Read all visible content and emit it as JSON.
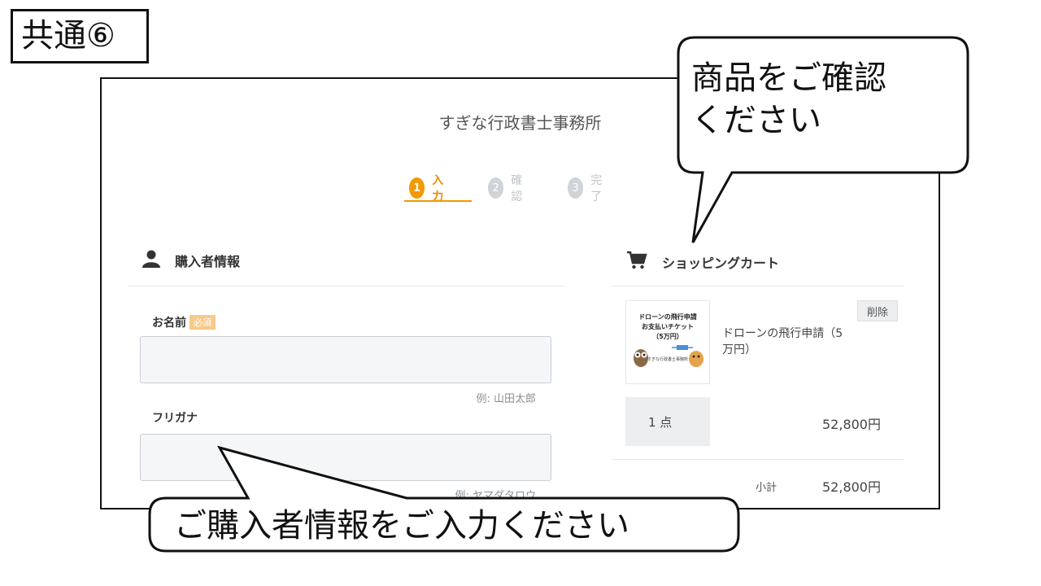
{
  "slide_label": "共通⑥",
  "site": {
    "title": "すぎな行政書士事務所"
  },
  "steps": [
    {
      "num": "1",
      "label": "入力",
      "active": true
    },
    {
      "num": "2",
      "label": "確認",
      "active": false
    },
    {
      "num": "3",
      "label": "完了",
      "active": false
    }
  ],
  "buyer": {
    "heading": "購入者情報",
    "heading_icon": "user-icon",
    "name_label": "お名前",
    "required_badge": "必須",
    "name_value": "",
    "name_example": "例: 山田太郎",
    "kana_label": "フリガナ",
    "kana_value": "",
    "kana_example": "例: ヤマダタロウ"
  },
  "cart": {
    "heading": "ショッピングカート",
    "heading_icon": "cart-icon",
    "item": {
      "image_text_line1": "ドローンの飛行申請",
      "image_text_line2": "お支払いチケット",
      "image_text_line3": "（5万円）",
      "image_footer": "すぎな行政書士事務所",
      "name": "ドローンの飛行申請（5万円）",
      "delete_label": "削除",
      "quantity": "1 点",
      "price": "52,800円"
    },
    "subtotal_label": "小計",
    "subtotal_value": "52,800円"
  },
  "callouts": {
    "product_check": "商品をご確認ください",
    "product_check_line1": "商品をご確認",
    "product_check_line2": "ください",
    "buyer_input": "ご購入者情報をご入力ください"
  },
  "colors": {
    "accent": "#f39800",
    "inactive_step": "#cfd4d9",
    "required_badge": "#f7c98a"
  }
}
